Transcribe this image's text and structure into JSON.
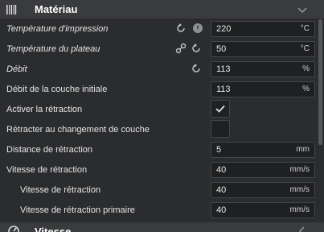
{
  "section": {
    "title": "Matériau",
    "icon": "material-spool-icon",
    "collapse_icon": "chevron-down-icon"
  },
  "settings": [
    {
      "label": "Température d'impression",
      "value": "220",
      "unit": "°C",
      "italic": true,
      "icons": [
        "reset-icon",
        "info-icon"
      ]
    },
    {
      "label": "Température du plateau",
      "value": "50",
      "unit": "°C",
      "italic": true,
      "icons": [
        "link-icon",
        "reset-icon"
      ]
    },
    {
      "label": "Débit",
      "value": "113",
      "unit": "%",
      "italic": true,
      "icons": [
        "reset-icon"
      ]
    },
    {
      "label": "Débit de la couche initiale",
      "value": "113",
      "unit": "%",
      "italic": false,
      "icons": []
    },
    {
      "label": "Activer la rétraction",
      "checked": true,
      "italic": false,
      "icons": []
    },
    {
      "label": "Rétracter au changement de couche",
      "checked": false,
      "italic": false,
      "icons": []
    },
    {
      "label": "Distance de rétraction",
      "value": "5",
      "unit": "mm",
      "italic": false,
      "icons": []
    },
    {
      "label": "Vitesse de rétraction",
      "value": "40",
      "unit": "mm/s",
      "italic": false,
      "icons": []
    },
    {
      "label": "Vitesse de rétraction",
      "value": "40",
      "unit": "mm/s",
      "italic": false,
      "icons": []
    },
    {
      "label": "Vitesse de rétraction primaire",
      "value": "40",
      "unit": "mm/s",
      "italic": false,
      "icons": []
    }
  ],
  "next_section": {
    "title": "Vitesse",
    "icon": "speed-gauge-icon"
  },
  "colors": {
    "background": "#2b2c2e",
    "header": "#3a3b3d",
    "field": "#1f2022",
    "text": "#e6e6e6"
  }
}
